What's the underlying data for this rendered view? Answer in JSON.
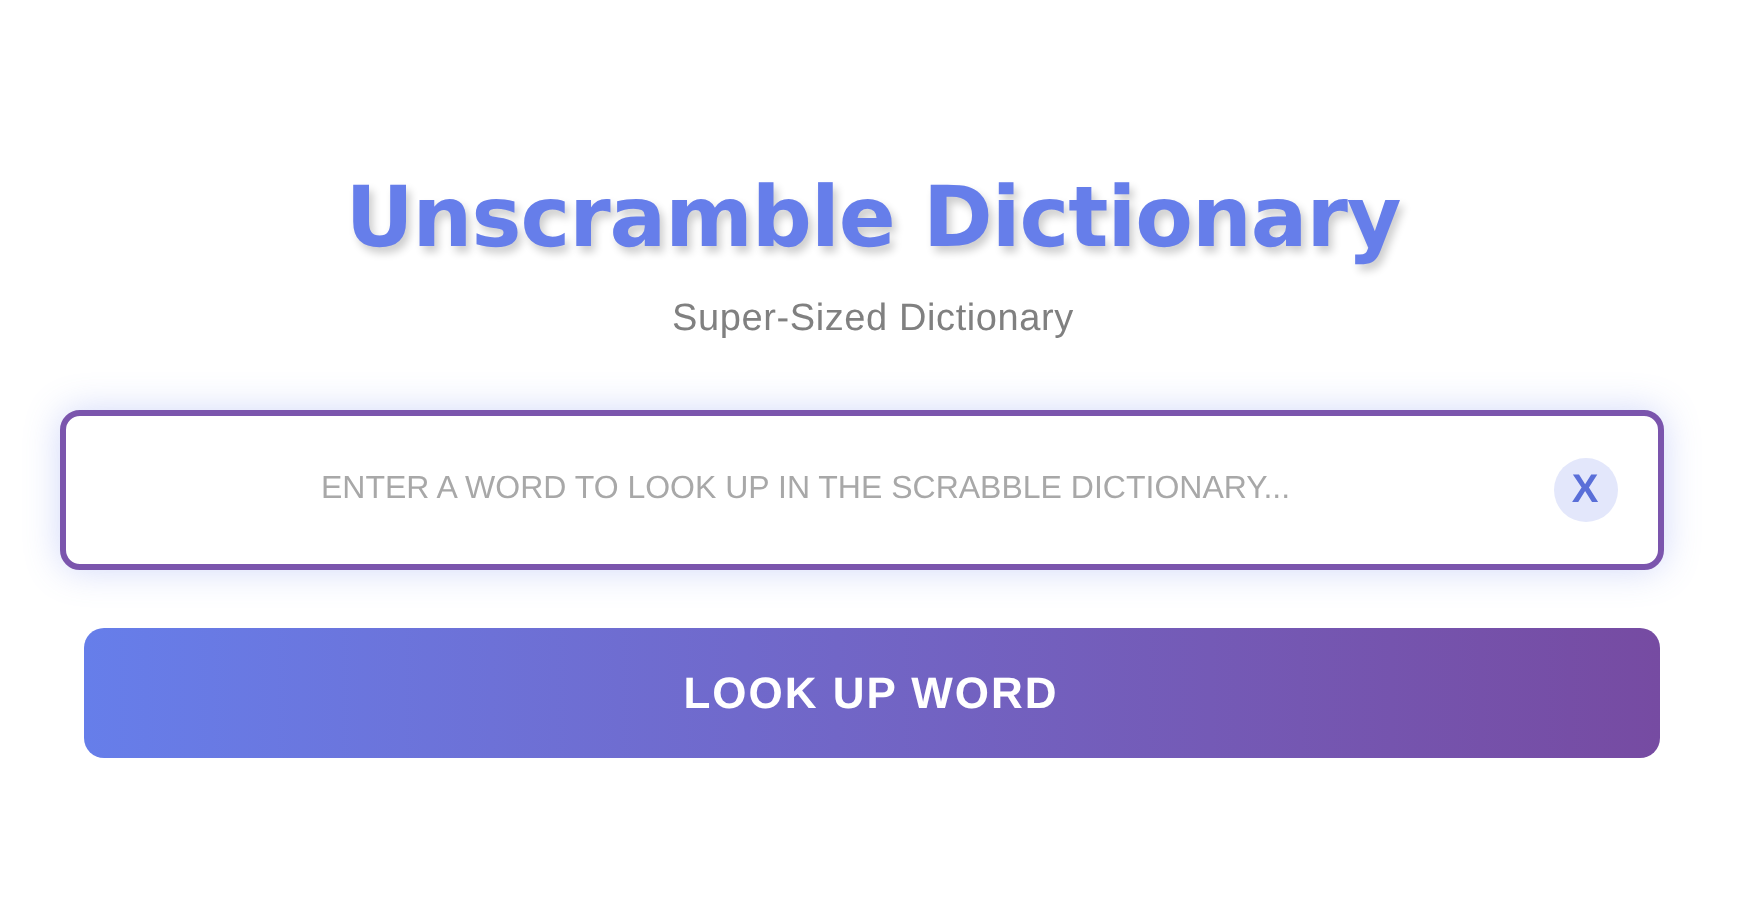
{
  "title": "Unscramble Dictionary",
  "subtitle": "Super-Sized Dictionary",
  "search": {
    "placeholder": "ENTER A WORD TO LOOK UP IN THE SCRABBLE DICTIONARY...",
    "clear_label": "X"
  },
  "button": {
    "label": "LOOK UP WORD"
  }
}
